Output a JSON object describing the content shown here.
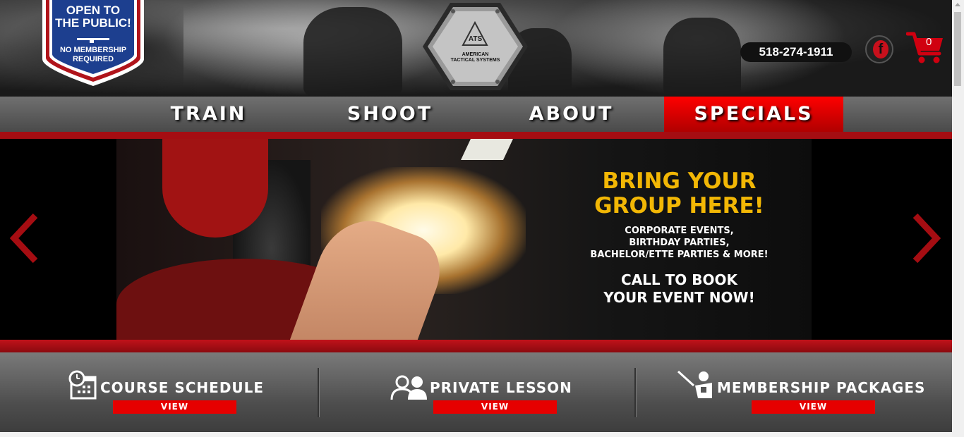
{
  "header": {
    "badge": {
      "line1": "OPEN TO",
      "line2": "THE PUBLIC!",
      "line3": "NO MEMBERSHIP",
      "line4": "REQUIRED"
    },
    "logo": {
      "mark": "ATS",
      "name_line1": "AMERICAN",
      "name_line2": "TACTICAL SYSTEMS"
    },
    "phone": "518-274-1911",
    "facebook_icon": "facebook-icon",
    "cart_count": "0"
  },
  "nav": {
    "items": [
      {
        "label": "TRAIN"
      },
      {
        "label": "SHOOT"
      },
      {
        "label": "ABOUT"
      },
      {
        "label": "SPECIALS",
        "active": true
      }
    ]
  },
  "hero": {
    "headline_line1": "BRING YOUR",
    "headline_line2": "GROUP HERE!",
    "sub_line1": "CORPORATE EVENTS,",
    "sub_line2": "BIRTHDAY PARTIES,",
    "sub_line3": "BACHELOR/ETTE PARTIES & MORE!",
    "cta_line1": "CALL TO BOOK",
    "cta_line2": "YOUR EVENT NOW!"
  },
  "features": [
    {
      "label": "COURSE SCHEDULE",
      "button": "VIEW",
      "icon": "calendar-clock-icon"
    },
    {
      "label": "PRIVATE LESSON",
      "button": "VIEW",
      "icon": "people-icon"
    },
    {
      "label": "MEMBERSHIP PACKAGES",
      "button": "VIEW",
      "icon": "instructor-icon"
    }
  ],
  "colors": {
    "accent_red": "#e60000",
    "dark_red": "#a50d12",
    "headline_gold": "#f2b705",
    "badge_blue": "#1d3f8f"
  }
}
